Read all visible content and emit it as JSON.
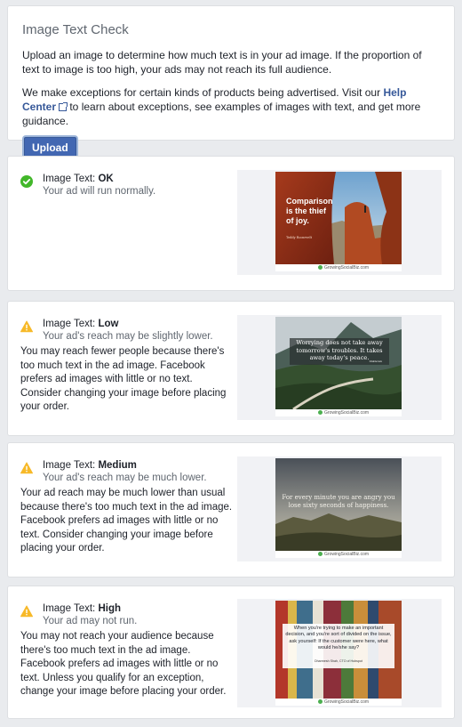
{
  "intro": {
    "title": "Image Text Check",
    "paragraph1": "Upload an image to determine how much text is in your ad image. If the proportion of text to image is too high, your ads may not reach its full audience.",
    "paragraph2_before": "We make exceptions for certain kinds of products being advertised. Visit our ",
    "help_link": "Help Center",
    "paragraph2_after": " to learn about exceptions, see examples of images with text, and get more guidance.",
    "upload_label": "Upload"
  },
  "results": [
    {
      "title_prefix": "Image Text: ",
      "rating": "OK",
      "subtitle": "Your ad will run normally.",
      "description": "",
      "icon": "check-circle-icon",
      "quote": "Comparison is the thief of joy.",
      "attribution": "Teddy Roosevelt",
      "watermark": "GrowingSocialBiz.com"
    },
    {
      "title_prefix": "Image Text: ",
      "rating": "Low",
      "subtitle": "Your ad's reach may be slightly lower.",
      "description": "You may reach fewer people because there's too much text in the ad image. Facebook prefers ad images with little or no text. Consider changing your image before placing your order.",
      "icon": "warning-icon",
      "quote": "Worrying does not take away tomorrow's troubles. It takes away today's peace.",
      "attribution": "Unknown",
      "watermark": "GrowingSocialBiz.com"
    },
    {
      "title_prefix": "Image Text: ",
      "rating": "Medium",
      "subtitle": "Your ad's reach may be much lower.",
      "description": "Your ad reach may be much lower than usual because there's too much text in the ad image. Facebook prefers ad images with little or no text. Consider changing your image before placing your order.",
      "icon": "warning-icon",
      "quote": "For every minute you are angry you lose sixty seconds of happiness.",
      "attribution": "",
      "watermark": "GrowingSocialBiz.com"
    },
    {
      "title_prefix": "Image Text: ",
      "rating": "High",
      "subtitle": "Your ad may not run.",
      "description": "You may not reach your audience because there's too much text in the ad image. Facebook prefers ad images with little or no text. Unless you qualify for an exception, change your image before placing your order.",
      "icon": "warning-icon",
      "quote": "When you're trying to make an important decision, and you're sort of divided on the issue, ask yourself: If the customer were here, what would he/she say?",
      "attribution": "Dharmesh Shah, CTO of Hubspot",
      "watermark": "GrowingSocialBiz.com"
    }
  ],
  "colors": {
    "ok": "#42b72a",
    "warning": "#f7b928",
    "link": "#365899",
    "button": "#4267b2"
  }
}
